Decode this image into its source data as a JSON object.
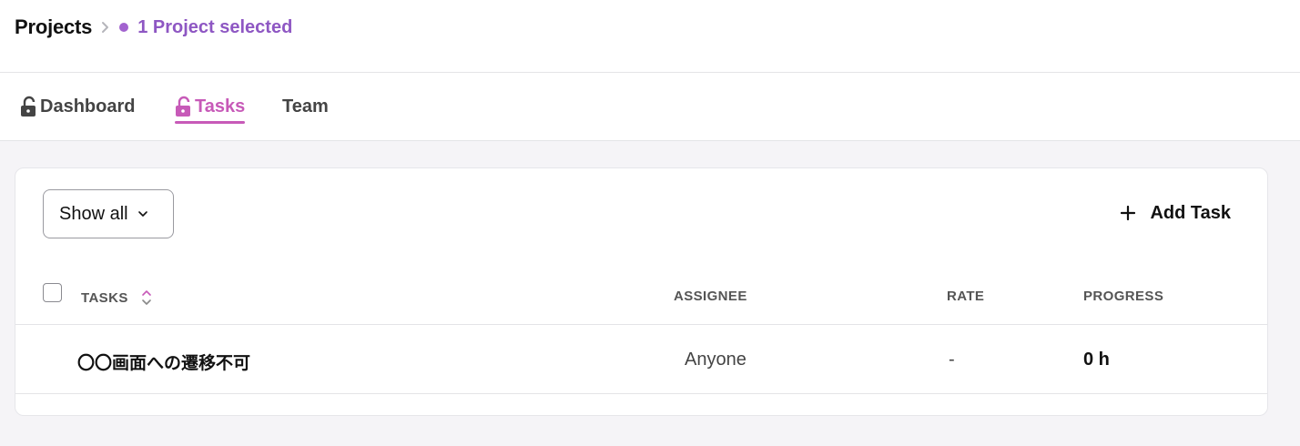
{
  "breadcrumb": {
    "root": "Projects",
    "current": "1 Project selected"
  },
  "tabs": [
    {
      "label": "Dashboard",
      "icon": "lock-open-icon",
      "active": false
    },
    {
      "label": "Tasks",
      "icon": "lock-open-icon",
      "active": true
    },
    {
      "label": "Team",
      "active": false
    }
  ],
  "toolbar": {
    "filter_label": "Show all",
    "add_task_label": "Add Task"
  },
  "table": {
    "columns": [
      "TASKS",
      "ASSIGNEE",
      "RATE",
      "PROGRESS"
    ],
    "rows": [
      {
        "task": "〇〇画面への遷移不可",
        "assignee": "Anyone",
        "rate": "-",
        "progress": "0 h"
      }
    ]
  },
  "colors": {
    "accent": "#c75ab8",
    "breadcrumb_purple": "#8e57c3",
    "dot": "#a263cf"
  }
}
